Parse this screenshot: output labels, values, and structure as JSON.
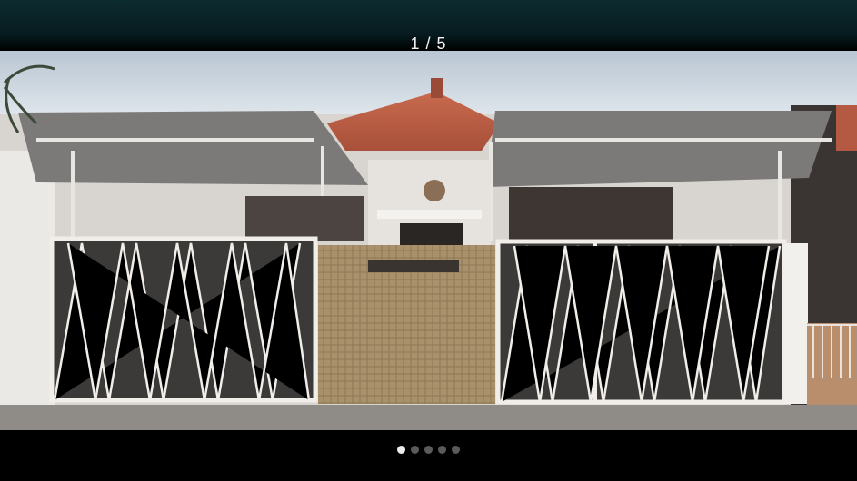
{
  "viewer": {
    "counter_text": "1 / 5",
    "current_index": 1,
    "total_images": 5,
    "dots": [
      {
        "active": true
      },
      {
        "active": false
      },
      {
        "active": false
      },
      {
        "active": false
      },
      {
        "active": false
      }
    ]
  },
  "photo": {
    "subject": "house-front-with-white-gates"
  },
  "colors": {
    "top_bar": "#0b2a2e",
    "background": "#000000",
    "dot_active": "#ececec",
    "dot_inactive": "#5a5a5a"
  }
}
